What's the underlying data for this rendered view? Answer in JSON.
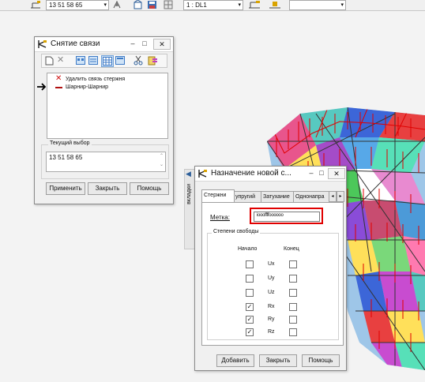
{
  "toolbar": {
    "node_list_value": "13 51 58 65",
    "layer_value": "1 : DL1"
  },
  "release_dialog": {
    "title": "Снятие связи",
    "items": [
      {
        "label": "Удалить связь стержня"
      },
      {
        "label": "Шарнир-Шарнир"
      }
    ],
    "current_selection_label": "Текущий выбор",
    "current_selection_value": "13 51 58 65",
    "buttons": {
      "apply": "Применить",
      "close": "Закрыть",
      "help": "Помощь"
    }
  },
  "side_tab": {
    "label": "вкладки"
  },
  "assign_dialog": {
    "title": "Назначение новой с...",
    "tabs": [
      "Стержни",
      "упругий",
      "Затухание",
      "Однонапра"
    ],
    "label_field_caption": "Метка:",
    "label_field_value": "ioooffffoooooo",
    "dof_group_title": "Степени свободы",
    "start_header": "Начало",
    "end_header": "Конец",
    "dofs": [
      {
        "name": "Ux",
        "start": false,
        "end": false
      },
      {
        "name": "Uy",
        "start": false,
        "end": false
      },
      {
        "name": "Uz",
        "start": false,
        "end": false
      },
      {
        "name": "Rx",
        "start": true,
        "end": false
      },
      {
        "name": "Ry",
        "start": true,
        "end": false
      },
      {
        "name": "Rz",
        "start": true,
        "end": false
      }
    ],
    "buttons": {
      "add": "Добавить",
      "close": "Закрыть",
      "help": "Помощь"
    }
  },
  "colors": {
    "highlight_red": "#e00000",
    "window_bg": "#f0f0f0",
    "selection_blue": "#3d7ac6"
  }
}
